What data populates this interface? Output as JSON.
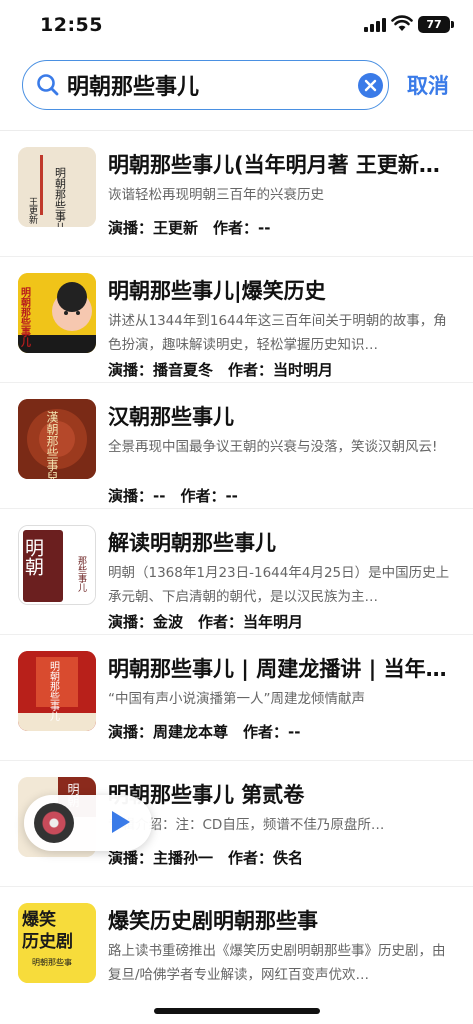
{
  "status_bar": {
    "time": "12:55",
    "battery": "77"
  },
  "search": {
    "query": "明朝那些事儿",
    "cancel_label": "取消"
  },
  "results": [
    {
      "title": "明朝那些事儿(当年明月著 王更新…",
      "desc": "诙谐轻松再现明朝三百年的兴衰历史",
      "meta": "演播：王更新　作者：--",
      "cover_icon": "book-cover-icon"
    },
    {
      "title": "明朝那些事儿|爆笑历史",
      "desc": "讲述从1344年到1644年这三百年间关于明朝的故事，角色扮演，趣味解读明史，轻松掌握历史知识…",
      "meta": "演播：播音夏冬　作者：当时明月",
      "cover_icon": "book-cover-icon"
    },
    {
      "title": "汉朝那些事儿",
      "desc": "全景再现中国最争议王朝的兴衰与没落，笑谈汉朝风云!",
      "meta": "演播：--　作者：--",
      "cover_icon": "book-cover-icon"
    },
    {
      "title": "解读明朝那些事儿",
      "desc": "明朝（1368年1月23日-1644年4月25日）是中国历史上承元朝、下启清朝的朝代，是以汉民族为主…",
      "meta": "演播：金波　作者：当年明月",
      "cover_icon": "book-cover-icon"
    },
    {
      "title": "明朝那些事儿 | 周建龙播讲 | 当年…",
      "desc": "“中国有声小说演播第一人”周建龙倾情献声",
      "meta": "演播：周建龙本尊　作者：--",
      "cover_icon": "book-cover-icon"
    },
    {
      "title": "明朝那些事儿 第贰卷",
      "desc": "专辑介绍：注：CD自压，频谱不佳乃原盘所…",
      "meta": "演播：主播孙一　作者：佚名",
      "cover_icon": "book-cover-icon"
    },
    {
      "title": "爆笑历史剧明朝那些事",
      "desc": "路上读书重磅推出《爆笑历史剧明朝那些事》历史剧，由复旦/哈佛学者专业解读，网红百变声优欢…",
      "meta": "",
      "cover_icon": "book-cover-icon"
    }
  ],
  "cover_text": {
    "c1": "明朝那些事儿",
    "c1_author": "王更新",
    "c2": "明朝那些事儿",
    "c3": "漢朝那些事兒",
    "c4_big": "明朝",
    "c4_small": "那些事儿",
    "c5": "明朝那些事儿",
    "c6": "明朝",
    "c7_line1": "爆笑",
    "c7_line2": "历史剧",
    "c7_line3": "明朝那些事"
  },
  "icons": {
    "search": "search-icon",
    "clear": "clear-icon",
    "play": "play-icon",
    "signal": "signal-icon",
    "wifi": "wifi-icon",
    "battery": "battery-icon"
  },
  "colors": {
    "accent": "#3a7be8",
    "title": "#111111",
    "desc": "#666666"
  }
}
